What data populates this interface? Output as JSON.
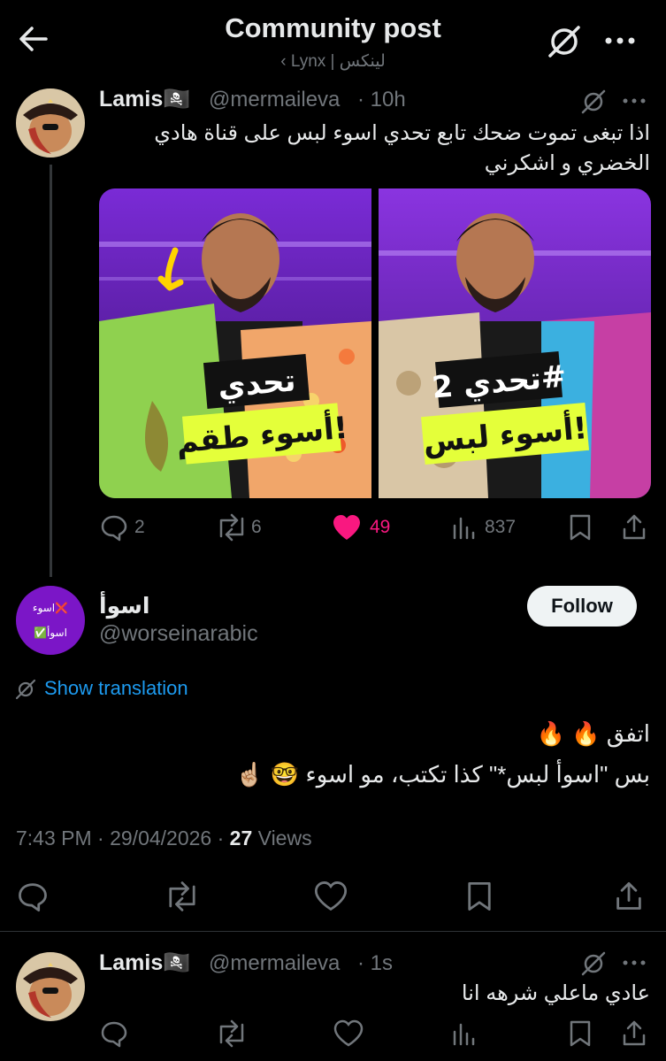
{
  "header": {
    "title": "Community post",
    "subtitle": "‹ Lynx | لينكس"
  },
  "post1": {
    "display_name": "Lamis🏴‍☠️",
    "handle": "@mermaileva",
    "time": "· 10h",
    "text_line1": "اذا تبغى تموت ضحك تابع تحدي اسوء لبس على قناة هادي",
    "text_line2": "الخضري و اشكرني",
    "thumb_left_title": "تحدي",
    "thumb_left_sub": "أسوء طقم!",
    "thumb_right_title": "تحدي 2#",
    "thumb_right_sub": "أسوء لبس!",
    "replies": "2",
    "reposts": "6",
    "likes": "49",
    "views": "837"
  },
  "post2": {
    "display_name": "اسوأ",
    "handle": "@worseinarabic",
    "avatar_line1": "اسوء❌",
    "avatar_line2": "✅اسوأ",
    "follow_label": "Follow",
    "show_translation": "Show translation",
    "text_line1": "اتفق 🔥 🔥",
    "text_line2": "بس \"اسوأ لبس*\" كذا تكتب، مو اسوء 🤓 ☝🏼",
    "timestamp": "7:43 PM · 29/04/2026 · ",
    "views_count": "27",
    "views_label": " Views"
  },
  "post3": {
    "display_name": "Lamis🏴‍☠️",
    "handle": "@mermaileva",
    "time": "· 1s",
    "text": "عادي ماعلي شرهه انا"
  },
  "colors": {
    "background": "#000000",
    "text": "#e7e9ea",
    "muted": "#71767b",
    "link": "#1d9bf0",
    "like": "#f91880",
    "follow_bg": "#eff3f4"
  }
}
